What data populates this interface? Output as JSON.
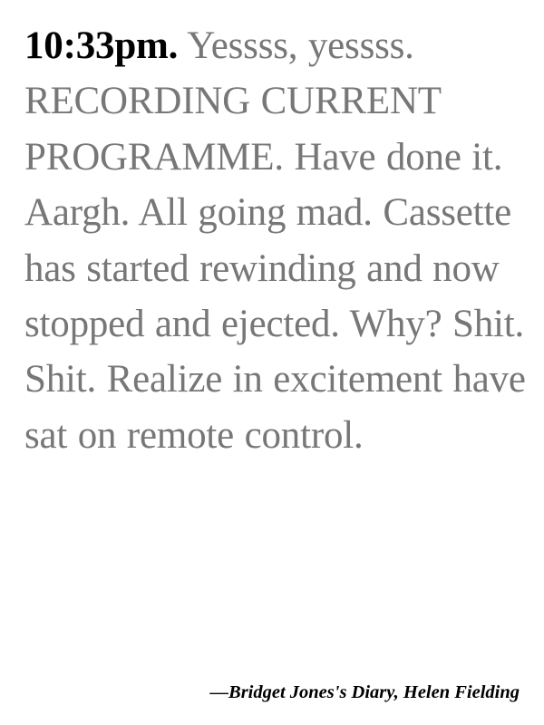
{
  "quote": {
    "time": "10:33pm.",
    "text": "Yessss, yessss. RECORDING CURRENT PROGRAMME. Have done it. Aargh. All going mad. Cassette has started rewinding and now stopped and ejected. Why? Shit. Shit. Realize in excitement have sat on remote control."
  },
  "attribution": {
    "text": "—Bridget Jones's Diary, Helen Fielding"
  },
  "colors": {
    "background": "#ffffff",
    "time_text": "#000000",
    "body_text": "#777777",
    "attribution_text": "#000000"
  }
}
